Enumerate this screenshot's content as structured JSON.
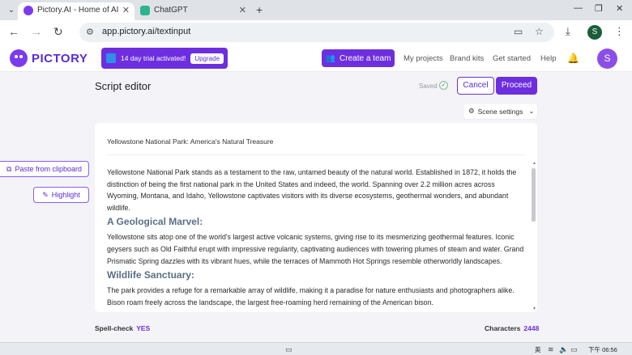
{
  "browser": {
    "tabs": [
      {
        "title": "Pictory.AI - Home of AI Vid",
        "active": true,
        "favicon_color": "#7c3aed"
      },
      {
        "title": "ChatGPT",
        "active": false,
        "favicon_color": "#2fb38f"
      }
    ],
    "address": "app.pictory.ai/textinput",
    "profile_letter": "S"
  },
  "header": {
    "logo_text": "PICTORY",
    "trial_text": "14 day trial activated!",
    "upgrade_label": "Upgrade",
    "create_team_label": "Create a team",
    "nav": [
      "My projects",
      "Brand kits",
      "Get started",
      "Help"
    ],
    "avatar_letter": "S"
  },
  "page": {
    "title": "Script editor",
    "saved_label": "Saved",
    "cancel_label": "Cancel",
    "proceed_label": "Proceed",
    "scene_settings_label": "Scene settings"
  },
  "side_actions": {
    "paste_label": "Paste from clipboard",
    "highlight_label": "Highlight"
  },
  "editor": {
    "title": "Yellowstone National Park: America's Natural Treasure",
    "intro": "Yellowstone National Park stands as a testament to the raw, untamed beauty of the natural world. Established in 1872, it holds the distinction of being the first national park in the United States and indeed, the world. Spanning over 2.2 million acres across Wyoming, Montana, and Idaho, Yellowstone captivates visitors with its diverse ecosystems, geothermal wonders, and abundant wildlife.",
    "section1_heading": "A Geological Marvel:",
    "section1_text": "Yellowstone sits atop one of the world's largest active volcanic systems, giving rise to its mesmerizing geothermal features. Iconic geysers such as Old Faithful erupt with impressive regularity, captivating audiences with towering plumes of steam and water. Grand Prismatic Spring dazzles with its vibrant hues, while the terraces of Mammoth Hot Springs resemble otherworldly landscapes.",
    "section2_heading": "Wildlife Sanctuary:",
    "section2_text": "The park provides a refuge for a remarkable array of wildlife, making it a paradise for nature enthusiasts and photographers alike. Bison roam freely across the landscape, the largest free-roaming herd remaining of the American bison."
  },
  "footer": {
    "spellcheck_label": "Spell-check",
    "spellcheck_value": "YES",
    "characters_label": "Characters",
    "characters_value": "2448"
  },
  "taskbar": {
    "ime": "英",
    "time": "下午 06:56"
  },
  "colors": {
    "brand": "#6d2ee0",
    "heading": "#5a6f86"
  }
}
